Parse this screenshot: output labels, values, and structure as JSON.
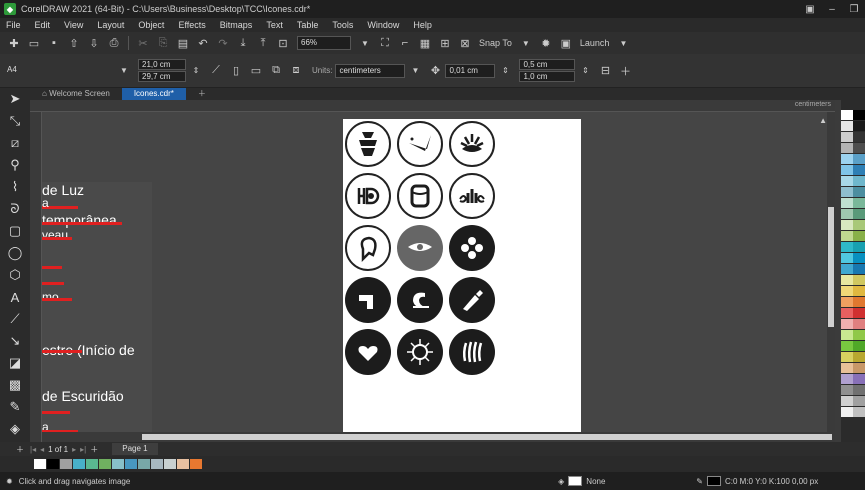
{
  "window": {
    "title": "CorelDRAW 2021 (64-Bit) - C:\\Users\\Business\\Desktop\\TCC\\Icones.cdr*"
  },
  "menu": [
    "File",
    "Edit",
    "View",
    "Layout",
    "Object",
    "Effects",
    "Bitmaps",
    "Text",
    "Table",
    "Tools",
    "Window",
    "Help"
  ],
  "toolbar": {
    "zoom": "66%",
    "snap_label": "Snap To",
    "launch_label": "Launch"
  },
  "property_bar": {
    "page_size": "A4",
    "width": "21,0 cm",
    "height": "29,7 cm",
    "units_label": "Units:",
    "units_value": "centimeters",
    "nudge": "0,01 cm",
    "dup_x": "0,5 cm",
    "dup_y": "1,0 cm"
  },
  "tabs": {
    "welcome": "Welcome Screen",
    "document": "Icones.cdr*"
  },
  "ruler_unit": "centimeters",
  "left_doc": {
    "lines": [
      "de Luz",
      "a",
      "temporânea",
      "veau",
      "mo",
      "estre (Início de",
      "de Escuridão",
      "a"
    ]
  },
  "pages": {
    "indicator": "1 of 1",
    "tab": "Page 1"
  },
  "status": {
    "hint": "Click and drag navigates image",
    "fill": "None",
    "outline": "C:0 M:0 Y:0 K:100  0,00 px"
  },
  "colors": {
    "accent": "#1f5fa8",
    "app_green": "#2e9a3a",
    "redline": "#e02020"
  }
}
